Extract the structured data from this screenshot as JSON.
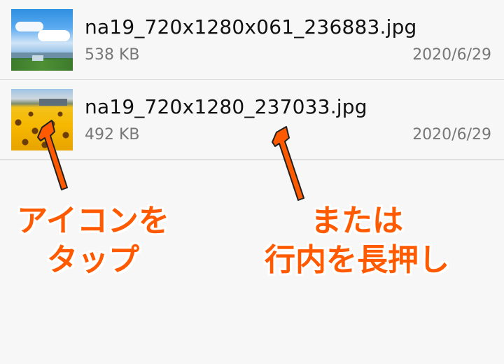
{
  "files": [
    {
      "name": "na19_720x1280x061_236883.jpg",
      "size": "538 KB",
      "date": "2020/6/29",
      "thumbnail": "sky-field-photo"
    },
    {
      "name": "na19_720x1280_237033.jpg",
      "size": "492 KB",
      "date": "2020/6/29",
      "thumbnail": "sunflower-field-photo"
    }
  ],
  "annotations": {
    "left": {
      "line1": "アイコンを",
      "line2": "タップ"
    },
    "right": {
      "line1": "または",
      "line2": "行内を長押し"
    }
  },
  "colors": {
    "annotation": "#ff5a00",
    "arrow_fill": "#ff5a00",
    "arrow_stroke": "#222222",
    "divider": "#e0e0e0"
  },
  "icons": {
    "arrow": "up-arrow-icon"
  }
}
